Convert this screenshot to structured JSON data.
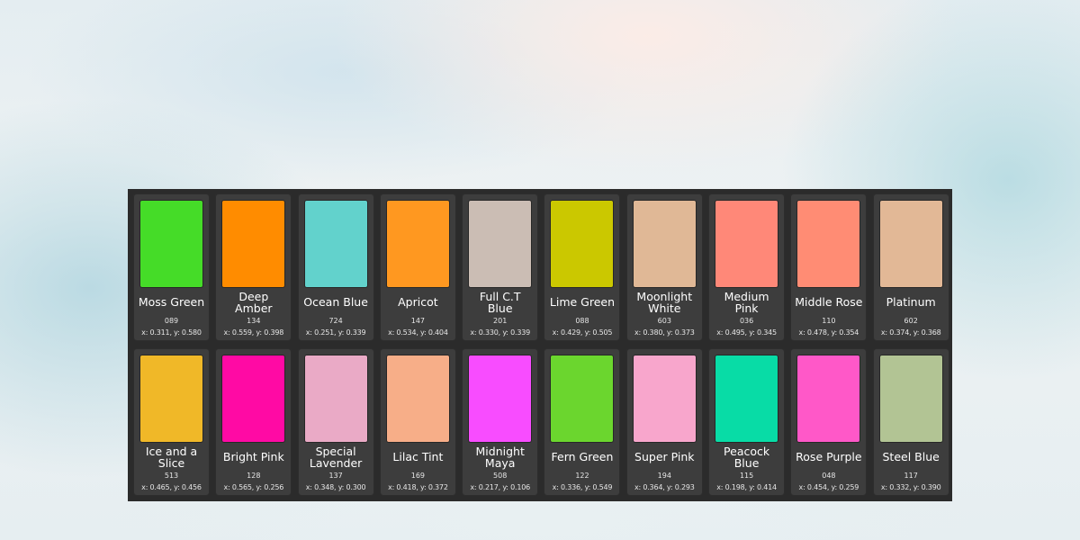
{
  "swatches": [
    {
      "name": "Moss Green",
      "code": "089",
      "coords": "x: 0.311, y: 0.580",
      "color": "#45dc28"
    },
    {
      "name": "Deep Amber",
      "code": "134",
      "coords": "x: 0.559, y: 0.398",
      "color": "#ff8c00"
    },
    {
      "name": "Ocean Blue",
      "code": "724",
      "coords": "x: 0.251, y: 0.339",
      "color": "#62d2cc"
    },
    {
      "name": "Apricot",
      "code": "147",
      "coords": "x: 0.534, y: 0.404",
      "color": "#ff9820"
    },
    {
      "name": "Full C.T Blue",
      "code": "201",
      "coords": "x: 0.330, y: 0.339",
      "color": "#cbbdb4"
    },
    {
      "name": "Lime Green",
      "code": "088",
      "coords": "x: 0.429, y: 0.505",
      "color": "#cbc800"
    },
    {
      "name": "Moonlight White",
      "code": "603",
      "coords": "x: 0.380, y: 0.373",
      "color": "#e0b896"
    },
    {
      "name": "Medium Pink",
      "code": "036",
      "coords": "x: 0.495, y: 0.345",
      "color": "#ff8878"
    },
    {
      "name": "Middle Rose",
      "code": "110",
      "coords": "x: 0.478, y: 0.354",
      "color": "#ff8c74"
    },
    {
      "name": "Platinum",
      "code": "602",
      "coords": "x: 0.374, y: 0.368",
      "color": "#e2b896"
    },
    {
      "name": "Ice and a Slice",
      "code": "513",
      "coords": "x: 0.465, y: 0.456",
      "color": "#f0b828"
    },
    {
      "name": "Bright Pink",
      "code": "128",
      "coords": "x: 0.565, y: 0.256",
      "color": "#ff0aa4"
    },
    {
      "name": "Special Lavender",
      "code": "137",
      "coords": "x: 0.348, y: 0.300",
      "color": "#eaaac6"
    },
    {
      "name": "Lilac Tint",
      "code": "169",
      "coords": "x: 0.418, y: 0.372",
      "color": "#f7ae88"
    },
    {
      "name": "Midnight Maya",
      "code": "508",
      "coords": "x: 0.217, y: 0.106",
      "color": "#f84cff"
    },
    {
      "name": "Fern Green",
      "code": "122",
      "coords": "x: 0.336, y: 0.549",
      "color": "#6bd62e"
    },
    {
      "name": "Super Pink",
      "code": "194",
      "coords": "x: 0.364, y: 0.293",
      "color": "#f8a6cc"
    },
    {
      "name": "Peacock Blue",
      "code": "115",
      "coords": "x: 0.198, y: 0.414",
      "color": "#08dca6"
    },
    {
      "name": "Rose Purple",
      "code": "048",
      "coords": "x: 0.454, y: 0.259",
      "color": "#ff58c8"
    },
    {
      "name": "Steel Blue",
      "code": "117",
      "coords": "x: 0.332, y: 0.390",
      "color": "#b2c494"
    }
  ]
}
